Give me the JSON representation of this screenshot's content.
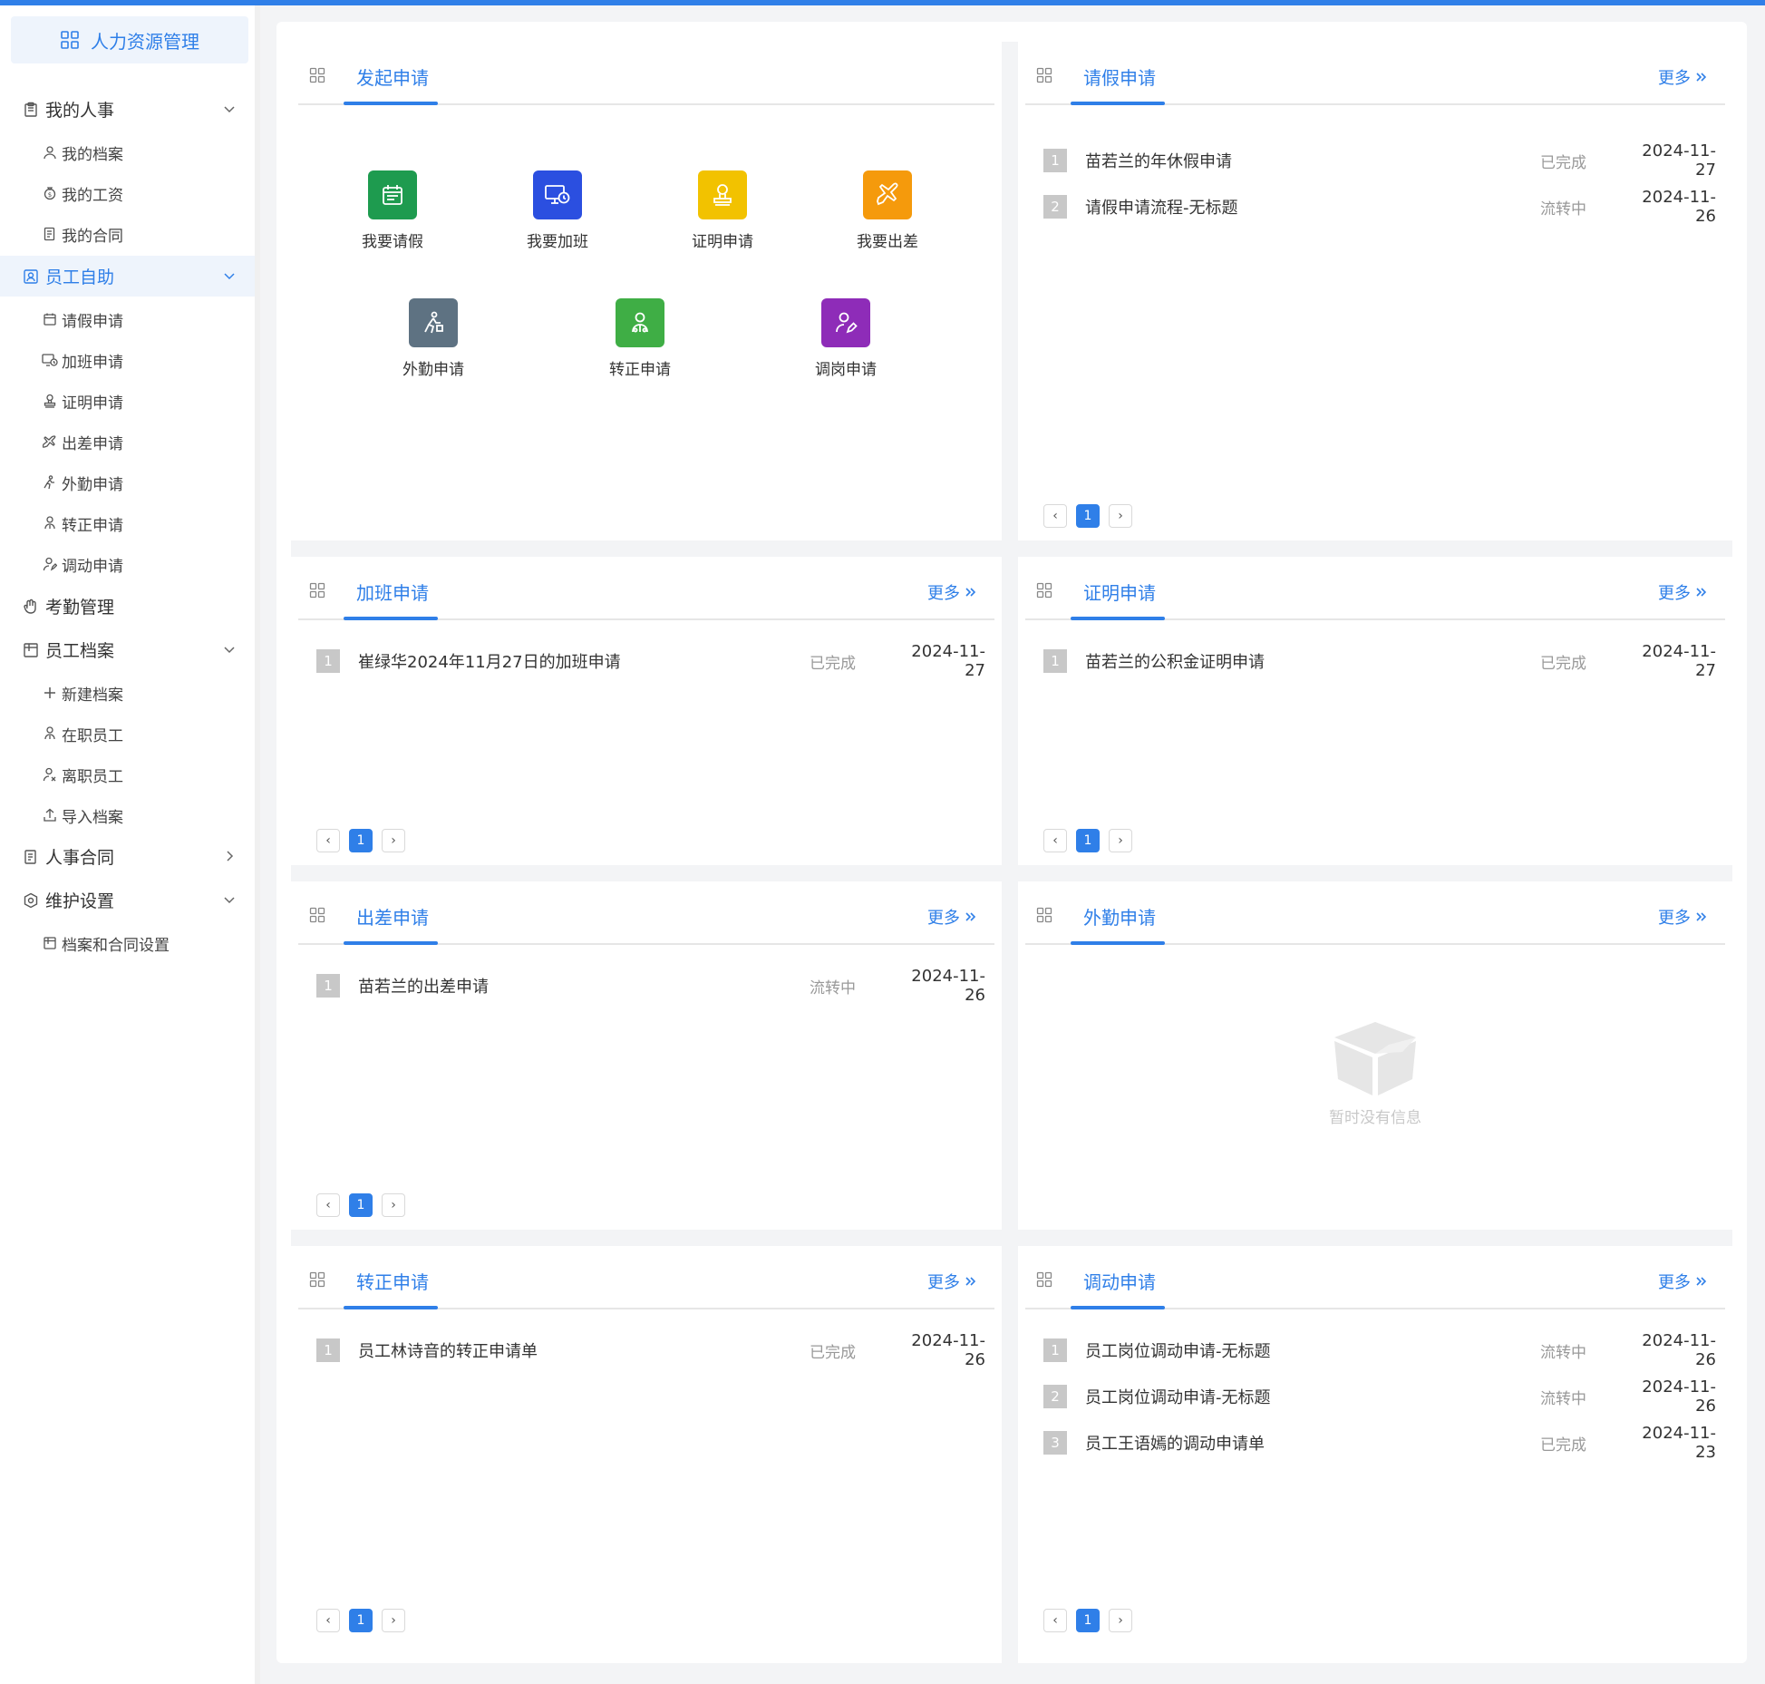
{
  "sidebar": {
    "logo": "人力资源管理",
    "items": [
      {
        "label": "我的人事"
      },
      {
        "label": "我的档案"
      },
      {
        "label": "我的工资"
      },
      {
        "label": "我的合同"
      },
      {
        "label": "员工自助"
      },
      {
        "label": "请假申请"
      },
      {
        "label": "加班申请"
      },
      {
        "label": "证明申请"
      },
      {
        "label": "出差申请"
      },
      {
        "label": "外勤申请"
      },
      {
        "label": "转正申请"
      },
      {
        "label": "调动申请"
      },
      {
        "label": "考勤管理"
      },
      {
        "label": "员工档案"
      },
      {
        "label": "新建档案"
      },
      {
        "label": "在职员工"
      },
      {
        "label": "离职员工"
      },
      {
        "label": "导入档案"
      },
      {
        "label": "人事合同"
      },
      {
        "label": "维护设置"
      },
      {
        "label": "档案和合同设置"
      }
    ]
  },
  "colors": {
    "accent": "#2f7fe8"
  },
  "launch": {
    "title": "发起申请",
    "apps": [
      {
        "label": "我要请假",
        "color": "#1e9b4f",
        "icon": "calendar-icon"
      },
      {
        "label": "我要加班",
        "color": "#2b4fe0",
        "icon": "monitor-clock-icon"
      },
      {
        "label": "证明申请",
        "color": "#f2c200",
        "icon": "stamp-icon"
      },
      {
        "label": "我要出差",
        "color": "#f59a0c",
        "icon": "plane-icon"
      },
      {
        "label": "外勤申请",
        "color": "#5e7282",
        "icon": "worker-icon"
      },
      {
        "label": "转正申请",
        "color": "#3fae45",
        "icon": "user-tree-icon"
      },
      {
        "label": "调岗申请",
        "color": "#8e2cb8",
        "icon": "user-edit-icon"
      }
    ]
  },
  "more_label": "更多",
  "empty_text": "暂时没有信息",
  "panels": {
    "leave": {
      "title": "请假申请",
      "rows": [
        {
          "num": "1",
          "text": "苗若兰的年休假申请",
          "status": "已完成",
          "date": "2024-11-27"
        },
        {
          "num": "2",
          "text": "请假申请流程-无标题",
          "status": "流转中",
          "date": "2024-11-26"
        }
      ],
      "page": "1"
    },
    "overtime": {
      "title": "加班申请",
      "rows": [
        {
          "num": "1",
          "text": "崔绿华2024年11月27日的加班申请",
          "status": "已完成",
          "date": "2024-11-27"
        }
      ],
      "page": "1"
    },
    "proof": {
      "title": "证明申请",
      "rows": [
        {
          "num": "1",
          "text": "苗若兰的公积金证明申请",
          "status": "已完成",
          "date": "2024-11-27"
        }
      ],
      "page": "1"
    },
    "trip": {
      "title": "出差申请",
      "rows": [
        {
          "num": "1",
          "text": "苗若兰的出差申请",
          "status": "流转中",
          "date": "2024-11-26"
        }
      ],
      "page": "1"
    },
    "field": {
      "title": "外勤申请",
      "rows": []
    },
    "regular": {
      "title": "转正申请",
      "rows": [
        {
          "num": "1",
          "text": "员工林诗音的转正申请单",
          "status": "已完成",
          "date": "2024-11-26"
        }
      ],
      "page": "1"
    },
    "transfer": {
      "title": "调动申请",
      "rows": [
        {
          "num": "1",
          "text": "员工岗位调动申请-无标题",
          "status": "流转中",
          "date": "2024-11-26"
        },
        {
          "num": "2",
          "text": "员工岗位调动申请-无标题",
          "status": "流转中",
          "date": "2024-11-26"
        },
        {
          "num": "3",
          "text": "员工王语嫣的调动申请单",
          "status": "已完成",
          "date": "2024-11-23"
        }
      ],
      "page": "1"
    }
  }
}
